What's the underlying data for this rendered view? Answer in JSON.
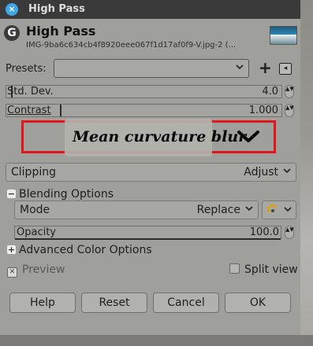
{
  "window": {
    "title": "High Pass",
    "close_glyph": "×"
  },
  "header": {
    "logo_text": "G",
    "filter_name": "High Pass",
    "image_name": "IMG-9ba6c634cb4f8920eee067f1d17af0f9-V.jpg-2 (..."
  },
  "presets": {
    "label": "Presets:",
    "value": "",
    "add_glyph": "+",
    "menu_glyph": "◂"
  },
  "params": {
    "std_dev": {
      "label": "Std. Dev.",
      "value": "4.0",
      "fill_fraction": 0.02
    },
    "contrast": {
      "label": "Contrast",
      "value": "1.000",
      "fill_fraction": 0.2
    }
  },
  "caption": {
    "text": "Mean curvature blur",
    "border_color": "#e2151a"
  },
  "clipping": {
    "label": "Clipping",
    "value": "Adjust"
  },
  "blending": {
    "expander_label": "Blending Options",
    "mode_label": "Mode",
    "mode_value": "Replace",
    "opacity_label": "Opacity",
    "opacity_value": "100.0",
    "opacity_fraction": 1.0
  },
  "advanced": {
    "label": "Advanced Color Options"
  },
  "preview": {
    "label": "Preview",
    "checked": true,
    "check_glyph": "✕"
  },
  "split_view": {
    "label": "Split view",
    "checked": false
  },
  "buttons": {
    "help": "Help",
    "reset": "Reset",
    "cancel": "Cancel",
    "ok": "OK"
  },
  "icons": {
    "close": "close-icon",
    "chevron": "chevron-down-icon",
    "expander_minus": "−",
    "expander_plus": "+",
    "spin_arrows": "▲▼"
  }
}
